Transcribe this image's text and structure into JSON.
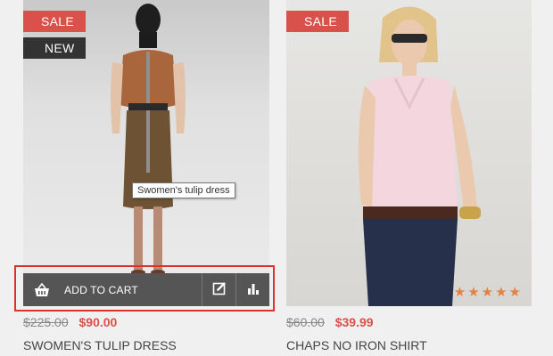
{
  "products": [
    {
      "badges": [
        "SALE",
        "NEW"
      ],
      "tooltip": "Swomen's tulip dress",
      "add_to_cart": "ADD TO CART",
      "old_price": "$225.00",
      "new_price": "$90.00",
      "name": "SWOMEN'S TULIP DRESS"
    },
    {
      "badges": [
        "SALE"
      ],
      "rating": 5,
      "old_price": "$60.00",
      "new_price": "$39.99",
      "name": "CHAPS NO IRON SHIRT"
    }
  ],
  "colors": {
    "sale_badge": "#d9514a",
    "new_badge": "#333333",
    "price_new": "#d9514a",
    "star": "#e7803c",
    "highlight": "#e0302b"
  },
  "icons": {
    "cart": "basket-icon",
    "edit": "edit-icon",
    "compare": "bar-chart-icon",
    "rating": "star-icon"
  }
}
